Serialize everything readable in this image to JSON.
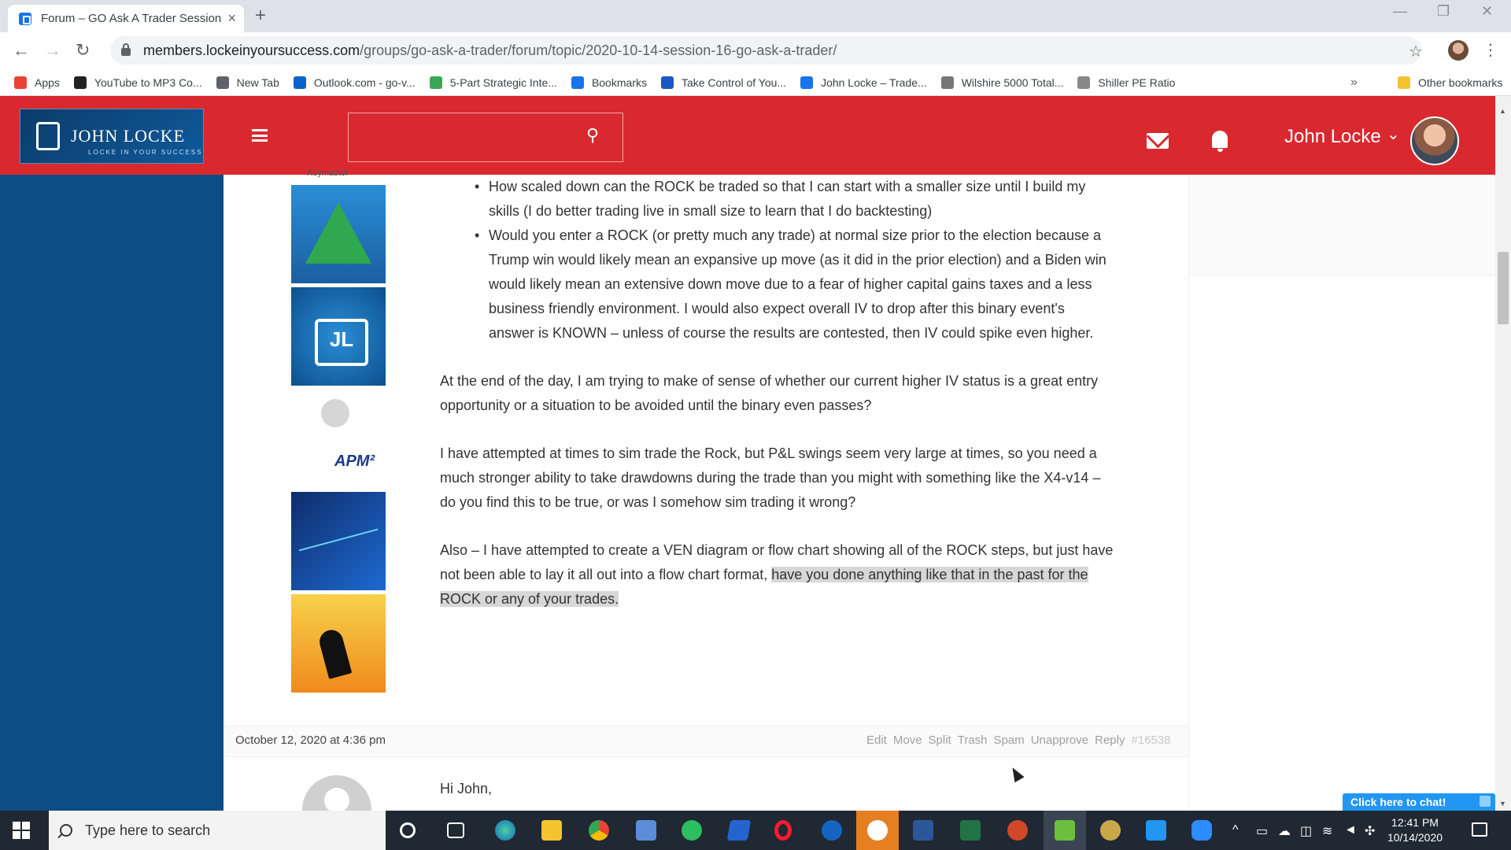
{
  "browser": {
    "tab_title": "Forum – GO Ask A Trader Session",
    "url_host": "members.lockeinyoursuccess.com",
    "url_path": "/groups/go-ask-a-trader/forum/topic/2020-10-14-session-16-go-ask-a-trader/",
    "bookmarks": [
      {
        "label": "Apps",
        "icon": "apps-grid-icon",
        "color": "#ea4335"
      },
      {
        "label": "YouTube to MP3 Co...",
        "icon": "music-note-icon",
        "color": "#222222"
      },
      {
        "label": "New Tab",
        "icon": "globe-icon",
        "color": "#5f6368"
      },
      {
        "label": "Outlook.com - go-v...",
        "icon": "outlook-icon",
        "color": "#0a64c9"
      },
      {
        "label": "5-Part Strategic Inte...",
        "icon": "target-icon",
        "color": "#3aa757"
      },
      {
        "label": "Bookmarks",
        "icon": "star-icon",
        "color": "#1a73e8"
      },
      {
        "label": "Take Control of You...",
        "icon": "circle-icon",
        "color": "#1a56c4"
      },
      {
        "label": "John Locke – Trade...",
        "icon": "lock-icon",
        "color": "#1a73e8"
      },
      {
        "label": "Wilshire 5000 Total...",
        "icon": "chart-icon",
        "color": "#777777"
      },
      {
        "label": "Shiller PE Ratio",
        "icon": "moon-icon",
        "color": "#888888"
      }
    ],
    "other_bookmarks": "Other bookmarks",
    "more": "»"
  },
  "header": {
    "logo_text": "JOHN LOCKE",
    "logo_sub": "LOCKE IN YOUR SUCCESS",
    "user_name": "John Locke",
    "colors": {
      "bar": "#d9292f",
      "sidebar": "#0d4d83"
    }
  },
  "sidebar_badges": {
    "top_label": "Keymaster"
  },
  "post": {
    "bullets": [
      "How scaled down can the ROCK be traded so that I can start with a smaller size until I build my skills (I do better trading live in small size to learn that I do backtesting)",
      "Would you enter a ROCK (or pretty much any trade) at normal size prior to the election because a Trump win would likely mean an expansive up move (as it did in the prior election) and a Biden win would likely mean an extensive down move due to a fear of higher capital gains taxes and a less business friendly environment.  I would also expect overall IV to drop after this binary event's answer is KNOWN – unless of course the results are contested, then IV could spike even higher."
    ],
    "paragraph_1": "At the end of the day, I am trying to make of sense of whether our current higher IV status is a great entry opportunity or a situation to be avoided until the binary even passes?",
    "paragraph_2": "I have attempted at times to sim trade the Rock, but P&L swings seem very large at times, so you need a much stronger ability to take drawdowns during the trade than you might with something like the X4-v14 – do you find this to be true, or was I somehow sim trading it wrong?",
    "paragraph_3_plain": "Also – I have attempted to create a VEN diagram or flow chart showing all of the ROCK steps, but just have not been able to lay it all out into a flow chart format, ",
    "paragraph_3_highlight": "have you done anything like that in the past for the ROCK or any of your trades."
  },
  "reply_meta": {
    "date": "October 12, 2020 at 4:36 pm",
    "actions": [
      "Edit",
      "Move",
      "Split",
      "Trash",
      "Spam",
      "Unapprove",
      "Reply"
    ],
    "post_id": "#16538",
    "greeting": "Hi John,"
  },
  "chat": {
    "label": "Click here to chat!"
  },
  "taskbar": {
    "search_placeholder": "Type here to search",
    "time": "12:41 PM",
    "date": "10/14/2020"
  }
}
